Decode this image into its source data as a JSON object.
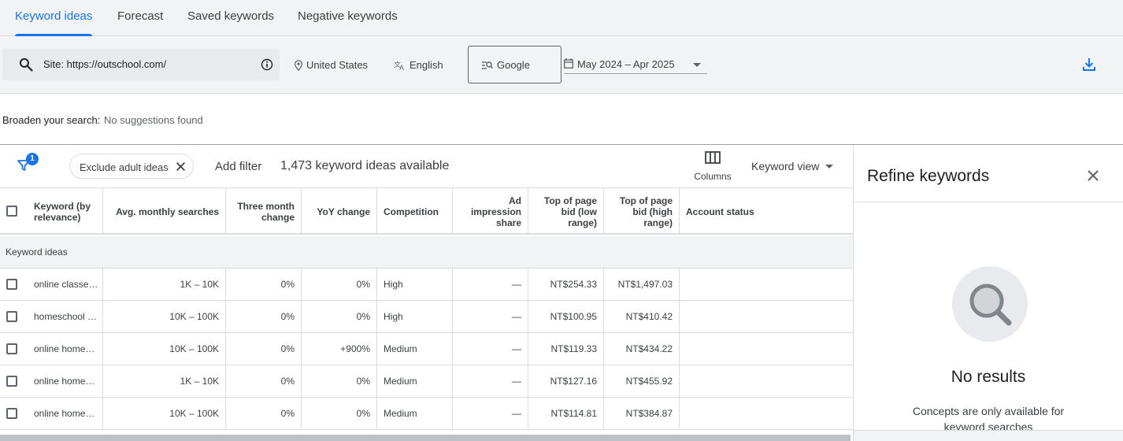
{
  "tabs": [
    "Keyword ideas",
    "Forecast",
    "Saved keywords",
    "Negative keywords"
  ],
  "search": {
    "value": "Site: https://outschool.com/"
  },
  "location": "United States",
  "language": "English",
  "network": "Google",
  "date_range": "May 2024 – Apr 2025",
  "broaden": {
    "label": "Broaden your search:",
    "value": "No suggestions found"
  },
  "toolbar": {
    "filter_badge": "1",
    "chip_label": "Exclude adult ideas",
    "add_filter": "Add filter",
    "ideas_count": "1,473 keyword ideas available",
    "columns_label": "Columns",
    "view_label": "Keyword view"
  },
  "table": {
    "headers": [
      "Keyword (by relevance)",
      "Avg. monthly searches",
      "Three month change",
      "YoY change",
      "Competition",
      "Ad impression share",
      "Top of page bid (low range)",
      "Top of page bid (high range)",
      "Account status"
    ],
    "group_label": "Keyword ideas",
    "rows": [
      [
        "online classe…",
        "1K – 10K",
        "0%",
        "0%",
        "High",
        "—",
        "NT$254.33",
        "NT$1,497.03",
        ""
      ],
      [
        "homeschool …",
        "10K – 100K",
        "0%",
        "0%",
        "High",
        "—",
        "NT$100.95",
        "NT$410.42",
        ""
      ],
      [
        "online home…",
        "10K – 100K",
        "0%",
        "+900%",
        "Medium",
        "—",
        "NT$119.33",
        "NT$434.22",
        ""
      ],
      [
        "online home…",
        "1K – 10K",
        "0%",
        "0%",
        "Medium",
        "—",
        "NT$127.16",
        "NT$455.92",
        ""
      ],
      [
        "online home…",
        "10K – 100K",
        "0%",
        "0%",
        "Medium",
        "—",
        "NT$114.81",
        "NT$384.87",
        ""
      ]
    ]
  },
  "refine": {
    "title": "Refine keywords",
    "no_results": "No results",
    "note": "Concepts are only available for keyword searches"
  },
  "colors": {
    "accent": "#1a73e8",
    "tab_bg": "#f1f3f4",
    "text": "#3c4043"
  }
}
